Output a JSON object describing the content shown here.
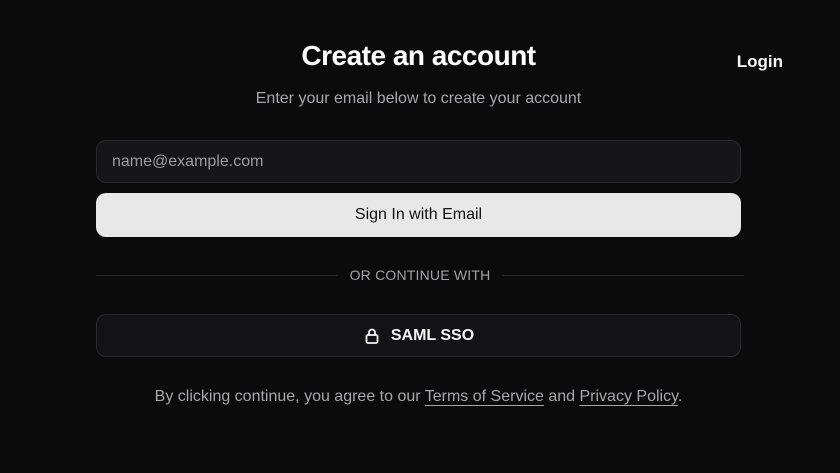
{
  "header": {
    "login_label": "Login"
  },
  "form": {
    "title": "Create an account",
    "subtitle": "Enter your email below to create your account",
    "email_placeholder": "name@example.com",
    "email_value": "",
    "submit_label": "Sign In with Email",
    "divider_text": "OR CONTINUE WITH",
    "sso_label": "SAML SSO",
    "sso_icon": "lock-icon"
  },
  "legal": {
    "prefix": "By clicking continue, you agree to our",
    "terms_label": "Terms of Service",
    "conjunction": "and",
    "privacy_label": "Privacy Policy",
    "suffix": "."
  },
  "colors": {
    "background": "#0b0b0c",
    "primary_button": "#e8e8e8",
    "muted_text": "#a7a7ab"
  }
}
